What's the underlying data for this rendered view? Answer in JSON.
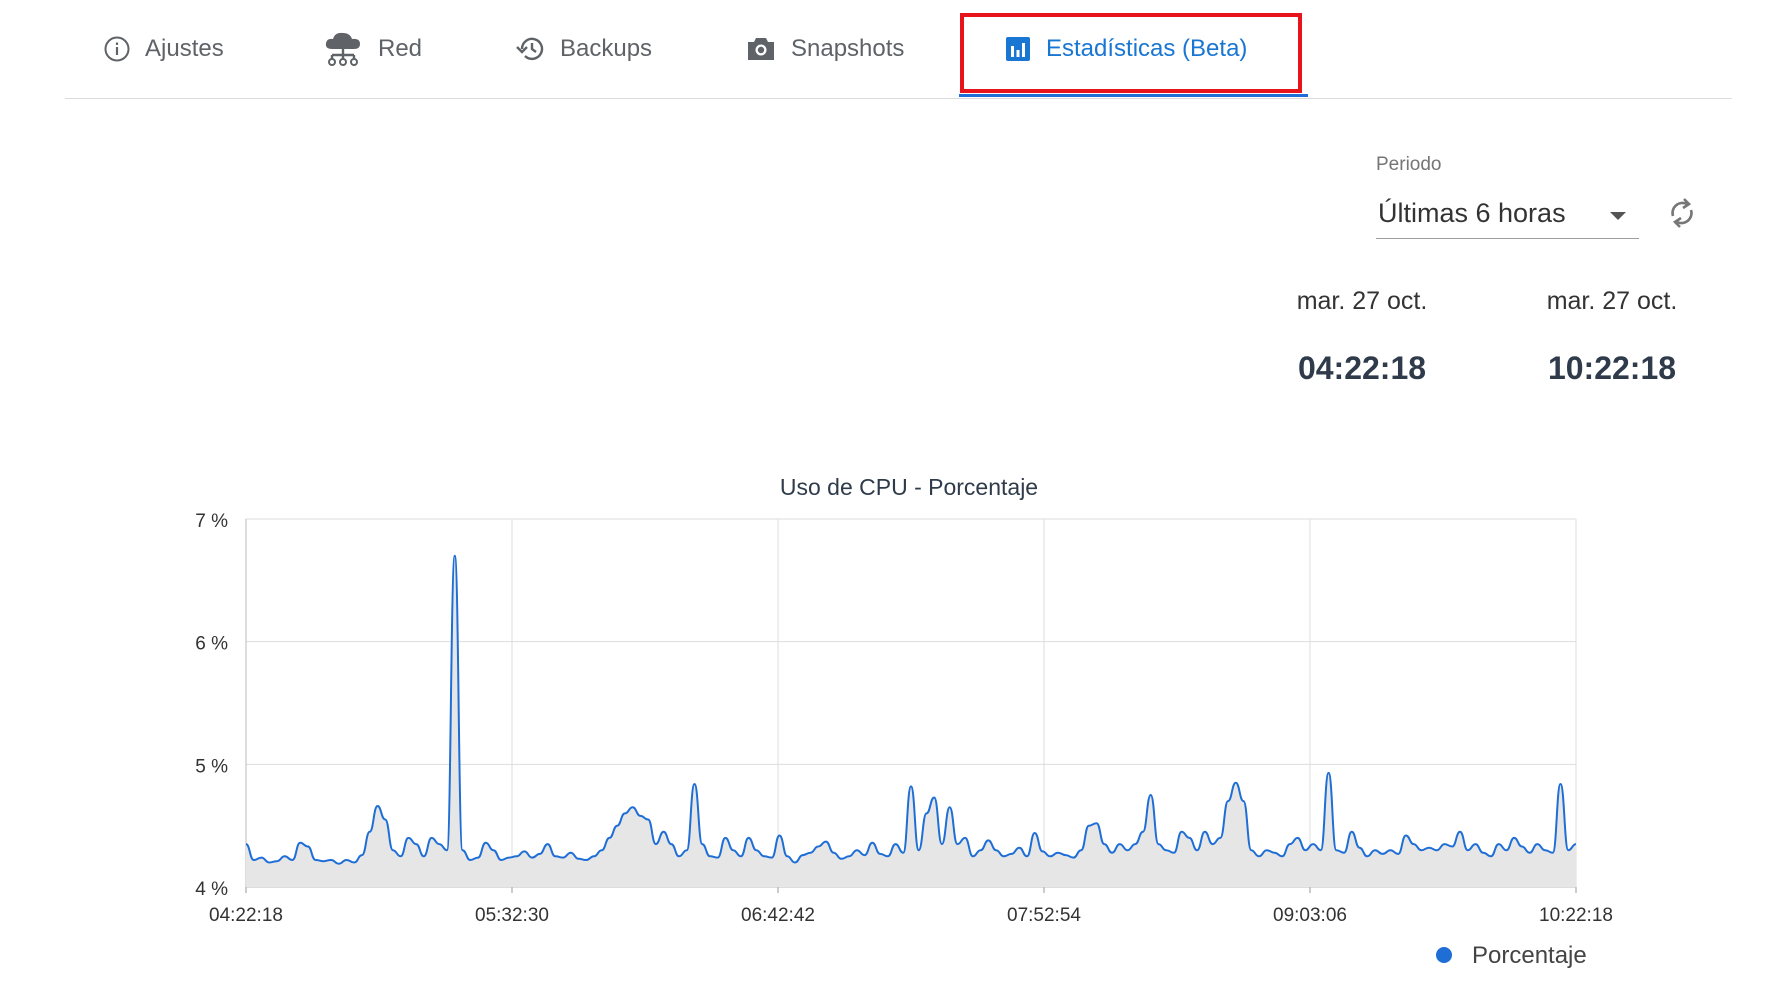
{
  "tabs": [
    {
      "label": "Ajustes",
      "icon": "info-icon",
      "active": false
    },
    {
      "label": "Red",
      "icon": "cloud-network-icon",
      "active": false
    },
    {
      "label": "Backups",
      "icon": "history-icon",
      "active": false
    },
    {
      "label": "Snapshots",
      "icon": "camera-icon",
      "active": false
    },
    {
      "label": "Estadísticas (Beta)",
      "icon": "bar-chart-icon",
      "active": true
    }
  ],
  "colors": {
    "accent": "#1976d2",
    "highlight": "#e8141c",
    "line": "#1e6ed6",
    "fill": "#e6e6e6"
  },
  "period": {
    "label": "Periodo",
    "value": "Últimas 6 horas"
  },
  "range": {
    "start": {
      "date": "mar. 27 oct.",
      "time": "04:22:18"
    },
    "end": {
      "date": "mar. 27 oct.",
      "time": "10:22:18"
    }
  },
  "chart_data": {
    "type": "area",
    "title": "Uso de CPU - Porcentaje",
    "xlabel": "",
    "ylabel": "",
    "ylim": [
      4,
      7
    ],
    "yticks": [
      "4 %",
      "5 %",
      "6 %",
      "7 %"
    ],
    "xticks": [
      "04:22:18",
      "05:32:30",
      "06:42:42",
      "07:52:54",
      "09:03:06",
      "10:22:18"
    ],
    "grid": true,
    "legend": "bottom-right",
    "series": [
      {
        "name": "Porcentaje",
        "values": [
          4.35,
          4.22,
          4.24,
          4.2,
          4.21,
          4.25,
          4.22,
          4.36,
          4.33,
          4.22,
          4.21,
          4.22,
          4.19,
          4.22,
          4.2,
          4.26,
          4.45,
          4.66,
          4.55,
          4.3,
          4.25,
          4.4,
          4.35,
          4.25,
          4.4,
          4.35,
          4.3,
          6.7,
          4.3,
          4.22,
          4.24,
          4.36,
          4.3,
          4.22,
          4.24,
          4.25,
          4.29,
          4.24,
          4.27,
          4.35,
          4.25,
          4.24,
          4.28,
          4.23,
          4.22,
          4.25,
          4.3,
          4.4,
          4.5,
          4.6,
          4.65,
          4.58,
          4.55,
          4.35,
          4.45,
          4.35,
          4.25,
          4.3,
          4.84,
          4.35,
          4.25,
          4.24,
          4.4,
          4.3,
          4.25,
          4.4,
          4.3,
          4.25,
          4.24,
          4.42,
          4.25,
          4.2,
          4.26,
          4.28,
          4.33,
          4.37,
          4.28,
          4.23,
          4.25,
          4.3,
          4.26,
          4.36,
          4.27,
          4.25,
          4.35,
          4.28,
          4.82,
          4.3,
          4.6,
          4.73,
          4.35,
          4.65,
          4.35,
          4.4,
          4.25,
          4.3,
          4.38,
          4.3,
          4.25,
          4.27,
          4.32,
          4.25,
          4.44,
          4.29,
          4.25,
          4.28,
          4.26,
          4.24,
          4.3,
          4.5,
          4.52,
          4.35,
          4.28,
          4.35,
          4.3,
          4.35,
          4.45,
          4.75,
          4.35,
          4.3,
          4.28,
          4.45,
          4.4,
          4.3,
          4.45,
          4.35,
          4.4,
          4.7,
          4.85,
          4.7,
          4.3,
          4.25,
          4.3,
          4.28,
          4.25,
          4.35,
          4.4,
          4.3,
          4.35,
          4.3,
          4.93,
          4.3,
          4.28,
          4.45,
          4.32,
          4.25,
          4.3,
          4.27,
          4.3,
          4.27,
          4.42,
          4.35,
          4.3,
          4.32,
          4.3,
          4.35,
          4.33,
          4.45,
          4.3,
          4.35,
          4.28,
          4.25,
          4.35,
          4.3,
          4.4,
          4.33,
          4.28,
          4.35,
          4.3,
          4.28,
          4.84,
          4.3,
          4.35
        ]
      }
    ]
  }
}
